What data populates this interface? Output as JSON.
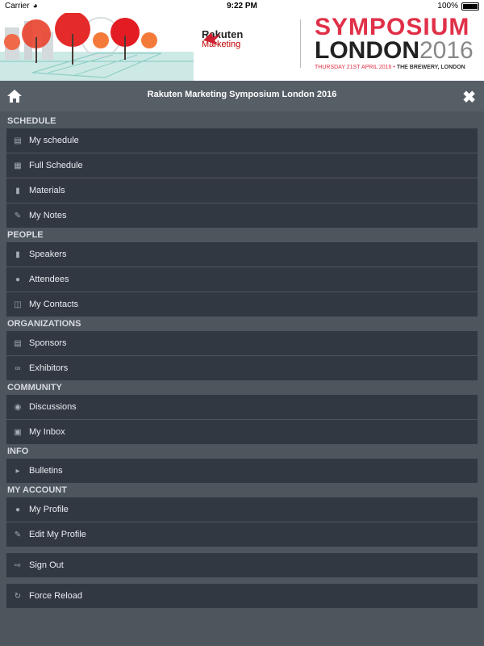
{
  "status": {
    "carrier": "Carrier",
    "time": "9:22 PM",
    "battery": "100%"
  },
  "banner": {
    "brand_title": "Rakuten",
    "brand_sub": "Marketing",
    "event_line1": "SYMPOSIUM",
    "event_line2": "LONDON",
    "event_year": "2016",
    "event_date": "THURSDAY 21ST APRIL 2016",
    "event_venue": "THE BREWERY, LONDON"
  },
  "header": {
    "title": "Rakuten Marketing Symposium London 2016"
  },
  "sections": [
    {
      "title": "SCHEDULE",
      "items": [
        {
          "label": "My schedule",
          "icon": "calendar-icon"
        },
        {
          "label": "Full Schedule",
          "icon": "calendar-grid-icon"
        },
        {
          "label": "Materials",
          "icon": "document-icon"
        },
        {
          "label": "My Notes",
          "icon": "pencil-icon"
        }
      ]
    },
    {
      "title": "PEOPLE",
      "items": [
        {
          "label": "Speakers",
          "icon": "bookmark-icon"
        },
        {
          "label": "Attendees",
          "icon": "user-icon"
        },
        {
          "label": "My Contacts",
          "icon": "book-icon"
        }
      ]
    },
    {
      "title": "ORGANIZATIONS",
      "items": [
        {
          "label": "Sponsors",
          "icon": "building-icon"
        },
        {
          "label": "Exhibitors",
          "icon": "link-icon"
        }
      ]
    },
    {
      "title": "COMMUNITY",
      "items": [
        {
          "label": "Discussions",
          "icon": "chat-icon"
        },
        {
          "label": "My Inbox",
          "icon": "inbox-icon"
        }
      ]
    },
    {
      "title": "INFO",
      "items": [
        {
          "label": "Bulletins",
          "icon": "megaphone-icon"
        }
      ]
    },
    {
      "title": "MY ACCOUNT",
      "items": [
        {
          "label": "My Profile",
          "icon": "user-icon"
        },
        {
          "label": "Edit My Profile",
          "icon": "pencil-icon"
        }
      ]
    }
  ],
  "actions": [
    {
      "label": "Sign Out",
      "icon": "sign-out-icon"
    },
    {
      "label": "Force Reload",
      "icon": "refresh-icon"
    }
  ]
}
